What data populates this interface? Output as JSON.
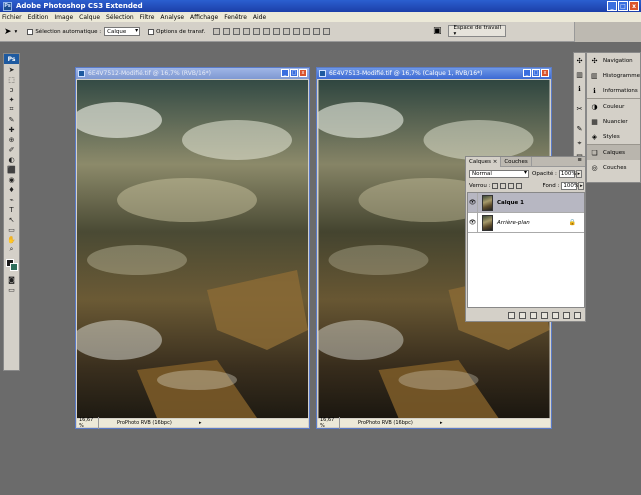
{
  "app": {
    "title": "Adobe Photoshop CS3 Extended",
    "logo": "Ps"
  },
  "window_controls": {
    "minimize": "_",
    "maximize": "□",
    "close": "x"
  },
  "menu": [
    "Fichier",
    "Edition",
    "Image",
    "Calque",
    "Sélection",
    "Filtre",
    "Analyse",
    "Affichage",
    "Fenêtre",
    "Aide"
  ],
  "options": {
    "auto_select_label": "Sélection automatique :",
    "auto_select_value": "Calque",
    "transform_label": "Options de transf.",
    "workspace_label": "Espace de travail ▾"
  },
  "toolbox": {
    "logo": "Ps",
    "tools": [
      "➤",
      "⬚",
      "ↄ",
      "✦",
      "⌗",
      "✎",
      "✚",
      "⊕",
      "✐",
      "◐",
      "⬛",
      "◉",
      "♦",
      "⌁",
      "T",
      "↖",
      "▭",
      "✋",
      "⌕"
    ]
  },
  "documents": [
    {
      "title": "6E4V7512-Modifié.tif @ 16,7% (RVB/16*)",
      "zoom": "16,67 %",
      "profile": "ProPhoto RVB (16bpc)",
      "active": false
    },
    {
      "title": "6E4V7513-Modifié.tif @ 16,7% (Calque 1, RVB/16*)",
      "zoom": "16,67 %",
      "profile": "ProPhoto RVB (16bpc)",
      "active": true
    }
  ],
  "dock": {
    "groups": [
      [
        {
          "label": "Navigation",
          "icon": "navigator-icon",
          "glyph": "✣"
        },
        {
          "label": "Histogramme",
          "icon": "histogram-icon",
          "glyph": "▥"
        },
        {
          "label": "Informations",
          "icon": "info-icon",
          "glyph": "ℹ"
        }
      ],
      [
        {
          "label": "Couleur",
          "icon": "color-icon",
          "glyph": "◑"
        },
        {
          "label": "Nuancier",
          "icon": "swatches-icon",
          "glyph": "▦"
        },
        {
          "label": "Styles",
          "icon": "styles-icon",
          "glyph": "◈"
        }
      ],
      [
        {
          "label": "Calques",
          "icon": "layers-icon",
          "glyph": "❏",
          "active": true
        },
        {
          "label": "Couches",
          "icon": "channels-icon",
          "glyph": "◎"
        }
      ]
    ]
  },
  "layers_panel": {
    "tabs": [
      "Calques ×",
      "Couches"
    ],
    "blend_mode": "Normal",
    "opacity_label": "Opacité :",
    "opacity_value": "100%",
    "lock_label": "Verrou :",
    "fill_label": "Fond :",
    "fill_value": "100%",
    "layers": [
      {
        "name": "Calque 1",
        "selected": true
      },
      {
        "name": "Arrière-plan",
        "selected": false,
        "locked": true
      }
    ],
    "bottom_icons": [
      "link-icon",
      "fx-icon",
      "mask-icon",
      "adjustment-icon",
      "folder-icon",
      "new-layer-icon",
      "trash-icon"
    ]
  }
}
